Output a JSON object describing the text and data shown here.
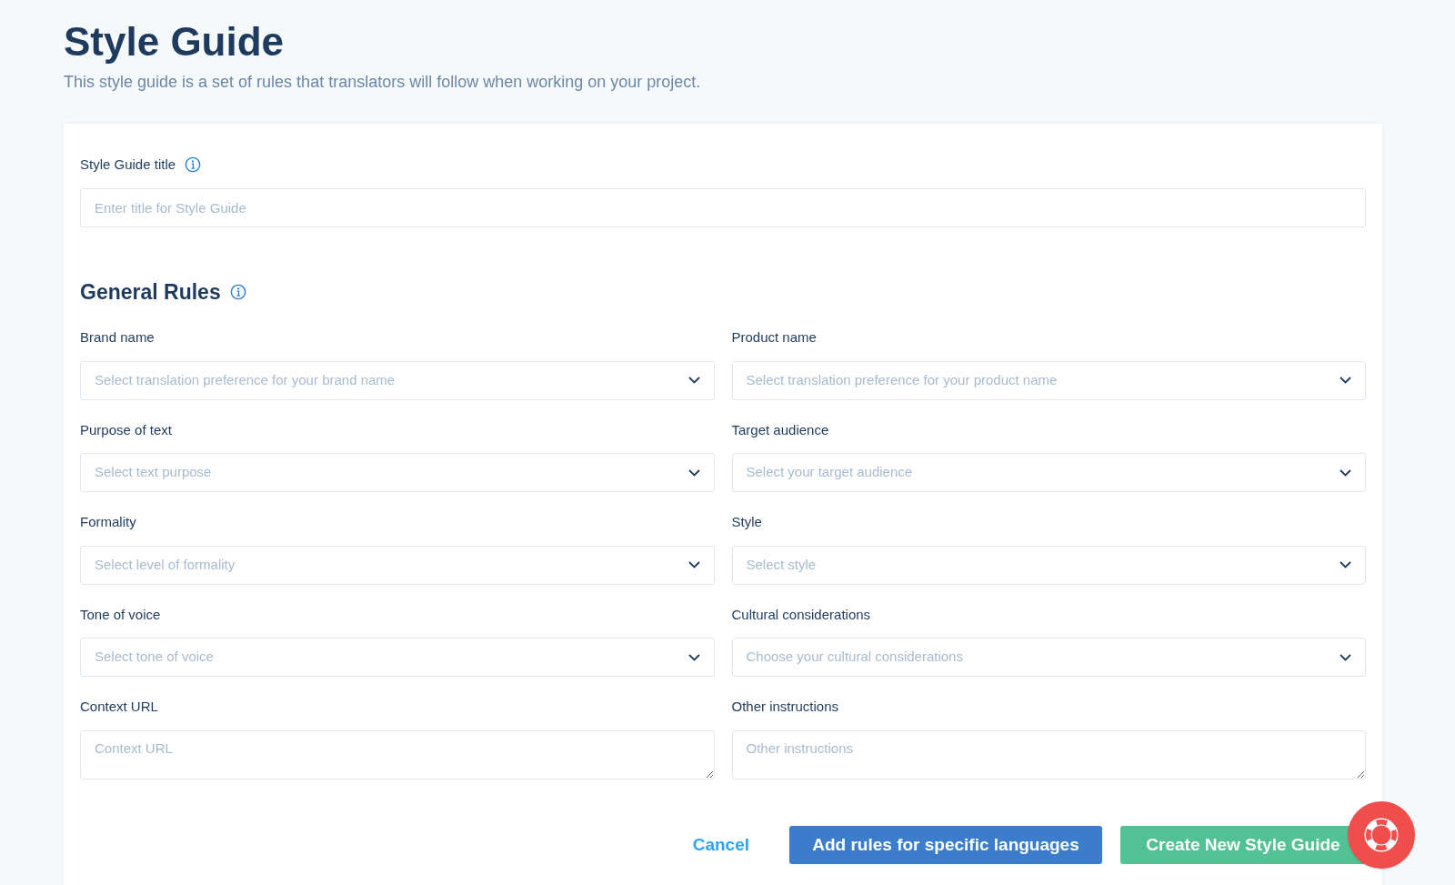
{
  "header": {
    "title": "Style Guide",
    "subtitle": "This style guide is a set of rules that translators will follow when working on your project."
  },
  "title_field": {
    "label": "Style Guide title",
    "placeholder": "Enter title for Style Guide"
  },
  "general_rules": {
    "heading": "General Rules",
    "fields": [
      {
        "kind": "select",
        "label": "Brand name",
        "placeholder": "Select translation preference for your brand name"
      },
      {
        "kind": "select",
        "label": "Product name",
        "placeholder": "Select translation preference for your product name"
      },
      {
        "kind": "select",
        "label": "Purpose of text",
        "placeholder": "Select text purpose"
      },
      {
        "kind": "select",
        "label": "Target audience",
        "placeholder": "Select your target audience"
      },
      {
        "kind": "select",
        "label": "Formality",
        "placeholder": "Select level of formality"
      },
      {
        "kind": "select",
        "label": "Style",
        "placeholder": "Select style"
      },
      {
        "kind": "select",
        "label": "Tone of voice",
        "placeholder": "Select tone of voice"
      },
      {
        "kind": "select",
        "label": "Cultural considerations",
        "placeholder": "Choose your cultural considerations"
      },
      {
        "kind": "textarea",
        "label": "Context URL",
        "placeholder": "Context URL"
      },
      {
        "kind": "textarea",
        "label": "Other instructions",
        "placeholder": "Other instructions"
      }
    ]
  },
  "actions": {
    "cancel": "Cancel",
    "add_rules": "Add rules for specific languages",
    "create": "Create New Style Guide"
  }
}
